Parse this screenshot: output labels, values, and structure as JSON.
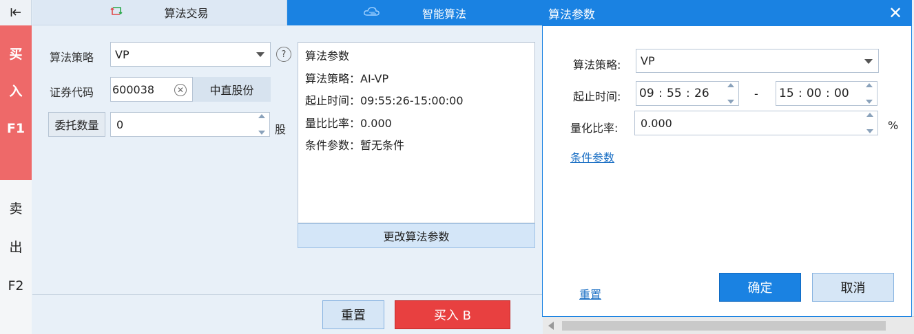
{
  "sidebar": {
    "collapse_icon": "collapse-left-icon",
    "buy_tab": [
      "买",
      "入",
      "F1"
    ],
    "sell_tab": [
      "卖",
      "出",
      "F2"
    ]
  },
  "tabs": {
    "trade_label": "算法交易",
    "algo_label": "智能算法"
  },
  "form": {
    "strategy_label": "算法策略",
    "strategy_value": "VP",
    "help_icon": "?",
    "code_label": "证券代码",
    "code_value": "600038",
    "stock_name": "中直股份",
    "qty_label": "委托数量",
    "qty_value": "0",
    "qty_unit": "股"
  },
  "summary": {
    "title": "算法参数",
    "strategy": "算法策略：AI-VP",
    "time": "起止时间：09:55:26-15:00:00",
    "ratio": "量比比率：0.000",
    "conditions": "条件参数：暂无条件",
    "change_button": "更改算法参数"
  },
  "actions": {
    "reset_label": "重置",
    "buy_label": "买入 B"
  },
  "dialog": {
    "title": "算法参数",
    "close_icon": "✕",
    "strategy_label": "算法策略:",
    "strategy_value": "VP",
    "time_label": "起止时间:",
    "start_h": "09",
    "start_m": "55",
    "start_s": "26",
    "range_dash": "-",
    "end_h": "15",
    "end_m": "00",
    "end_s": "00",
    "ratio_label": "量化比率:",
    "ratio_value": "0.000",
    "ratio_unit": "%",
    "conditions_link": "条件参数",
    "reset_link": "重置",
    "ok_label": "确定",
    "cancel_label": "取消"
  },
  "colors": {
    "accent": "#1a82e2",
    "buy": "#e84040",
    "buy_tab": "#ee6969"
  }
}
